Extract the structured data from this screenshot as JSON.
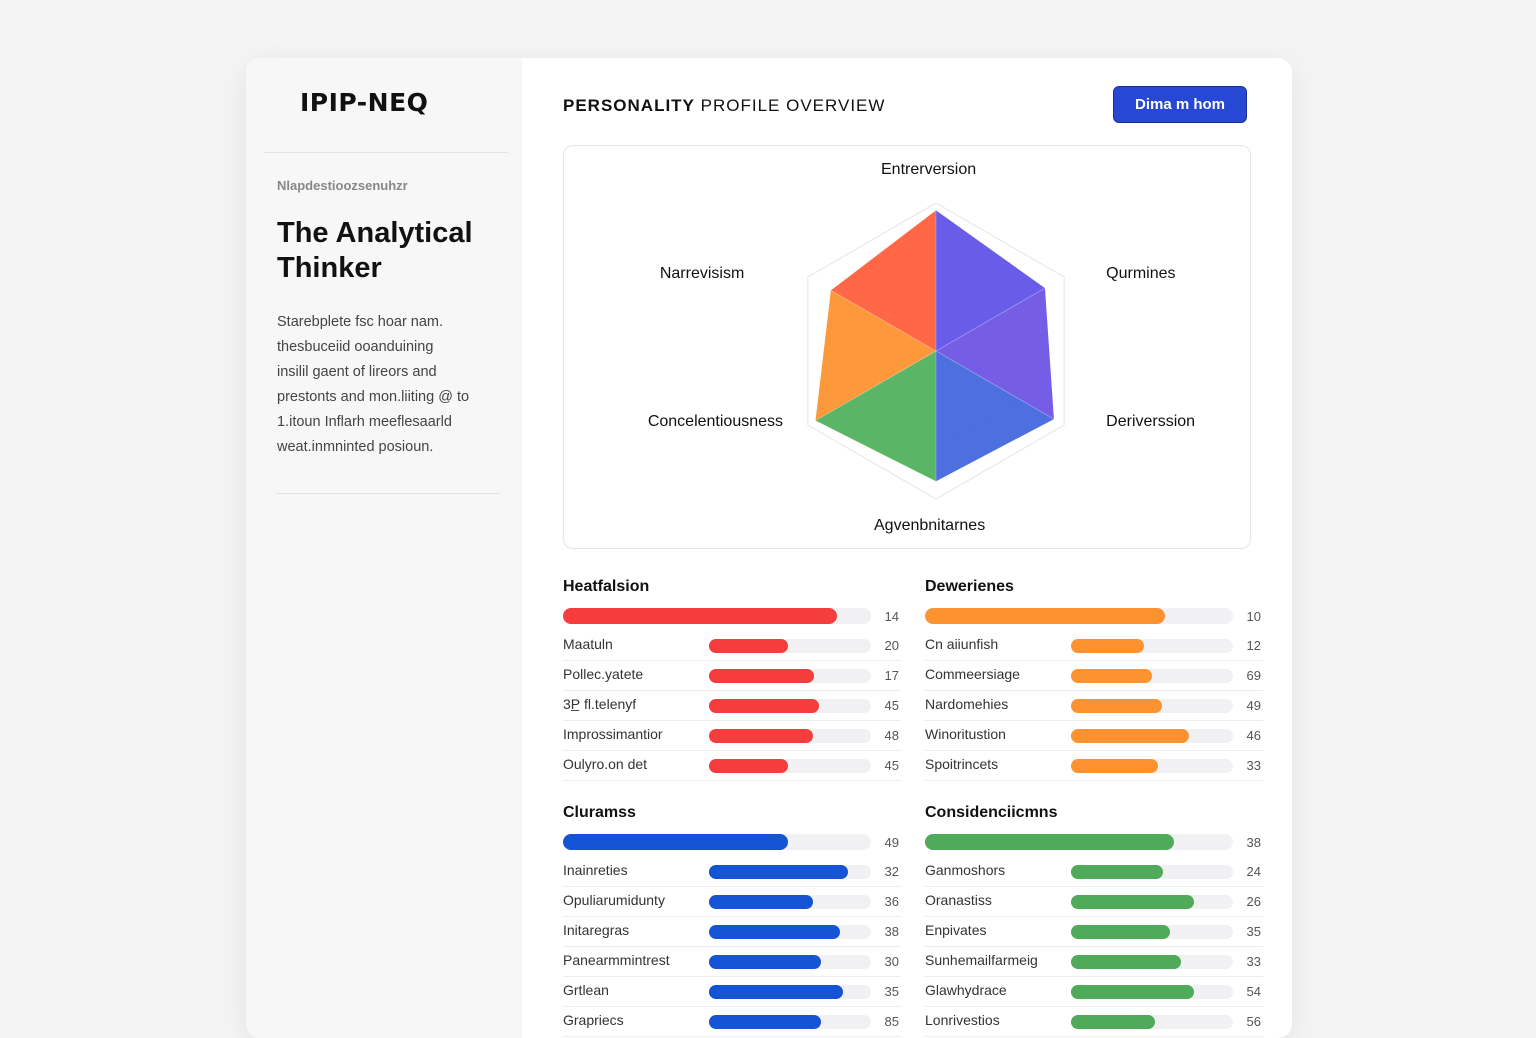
{
  "app": {
    "logo": "IPIP-NEQ"
  },
  "sidebar": {
    "eyebrow": "Nlapdestioozsenuhzr",
    "persona_title": "The Analytical Thinker",
    "description_lines": [
      "Starebplete fsc hoar nam.",
      "thesbuceiid ooanduining",
      "insilil gaent of lireors and",
      "prestonts and mon.liiting @ to",
      "1.itoun Inflarh meeflesaarld",
      "weat.inmninted posioun."
    ]
  },
  "header": {
    "title_bold": "PERSONALITY",
    "title_rest": "PROFILE OVERVIEW",
    "cta_label": "Dima m hom"
  },
  "radar": {
    "axes": [
      {
        "label": "Entrerversion",
        "value": 0.95,
        "color": "#5b4ee6"
      },
      {
        "label": "Qurmines",
        "value": 0.85,
        "color": "#6a4fe3"
      },
      {
        "label": "Deriverssion",
        "value": 0.92,
        "color": "#3f63dc"
      },
      {
        "label": "Agvenbnitarnes",
        "value": 0.88,
        "color": "#4caf5a"
      },
      {
        "label": "Concelentiousness",
        "value": 0.94,
        "color": "#fd8f2a"
      },
      {
        "label": "Narrevisism",
        "value": 0.82,
        "color": "#ff5a36"
      }
    ]
  },
  "sections": [
    {
      "title": "Heatfalsion",
      "color": "#f53d3d",
      "main_value": "14",
      "main_fill": 0.89,
      "rows": [
        {
          "label": "Maatuln",
          "value": "20",
          "fill": 0.49
        },
        {
          "label": "Pollec.yatete",
          "value": "17",
          "fill": 0.65
        },
        {
          "label": "3P̲ fl.telenyf",
          "value": "45",
          "fill": 0.68
        },
        {
          "label": "Improssimantior",
          "value": "48",
          "fill": 0.64
        },
        {
          "label": "Oulyro.on det",
          "value": "45",
          "fill": 0.49
        }
      ]
    },
    {
      "title": "Dewerienes",
      "color": "#fc9330",
      "main_value": "10",
      "main_fill": 0.78,
      "rows": [
        {
          "label": "Cn aiiunfish",
          "value": "12",
          "fill": 0.45
        },
        {
          "label": "Commeersiage",
          "value": "69",
          "fill": 0.5
        },
        {
          "label": "Nardomehies",
          "value": "49",
          "fill": 0.56
        },
        {
          "label": "Winoritustion",
          "value": "46",
          "fill": 0.73
        },
        {
          "label": "Spoitrincets",
          "value": "33",
          "fill": 0.54
        }
      ]
    },
    {
      "title": "Cluramss",
      "color": "#1554d4",
      "main_value": "49",
      "main_fill": 0.73,
      "rows": [
        {
          "label": "Inainreties",
          "value": "32",
          "fill": 0.86
        },
        {
          "label": "Opuliarumidunty",
          "value": "36",
          "fill": 0.64
        },
        {
          "label": "Initaregras",
          "value": "38",
          "fill": 0.81
        },
        {
          "label": "Panearmmintrest",
          "value": "30",
          "fill": 0.69
        },
        {
          "label": "Grtlean",
          "value": "35",
          "fill": 0.83
        },
        {
          "label": "Grapriecs",
          "value": "85",
          "fill": 0.69
        }
      ]
    },
    {
      "title": "Considenciicmns",
      "color": "#4faa59",
      "main_value": "38",
      "main_fill": 0.81,
      "rows": [
        {
          "label": "Ganmoshors",
          "value": "24",
          "fill": 0.57
        },
        {
          "label": "Oranastiss",
          "value": "26",
          "fill": 0.76
        },
        {
          "label": "Enpivates",
          "value": "35",
          "fill": 0.61
        },
        {
          "label": "Sunhemailfarmeig",
          "value": "33",
          "fill": 0.68
        },
        {
          "label": "Glawhydrace",
          "value": "54",
          "fill": 0.76
        },
        {
          "label": "Lonrivestios",
          "value": "56",
          "fill": 0.52
        }
      ]
    }
  ]
}
